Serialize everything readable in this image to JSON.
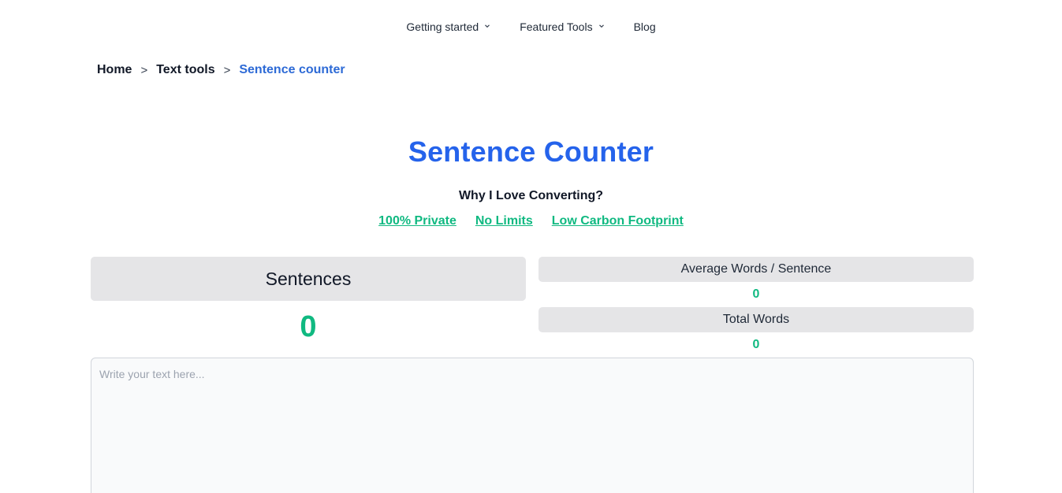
{
  "nav": {
    "items": [
      {
        "label": "Getting started",
        "has_dropdown": true
      },
      {
        "label": "Featured Tools",
        "has_dropdown": true
      },
      {
        "label": "Blog",
        "has_dropdown": false
      }
    ]
  },
  "breadcrumb": {
    "items": [
      "Home",
      "Text tools",
      "Sentence counter"
    ],
    "separator": ">"
  },
  "hero": {
    "title": "Sentence Counter",
    "subtitle": "Why I Love Converting?",
    "features": [
      "100% Private",
      "No Limits",
      "Low Carbon Footprint"
    ]
  },
  "stats": {
    "sentences_label": "Sentences",
    "sentences_value": "0",
    "avg_words_label": "Average Words / Sentence",
    "avg_words_value": "0",
    "total_words_label": "Total Words",
    "total_words_value": "0"
  },
  "editor": {
    "placeholder": "Write your text here...",
    "value": ""
  },
  "colors": {
    "accent_blue": "#2563eb",
    "accent_green": "#10b981",
    "panel_gray": "#e5e5e7"
  }
}
